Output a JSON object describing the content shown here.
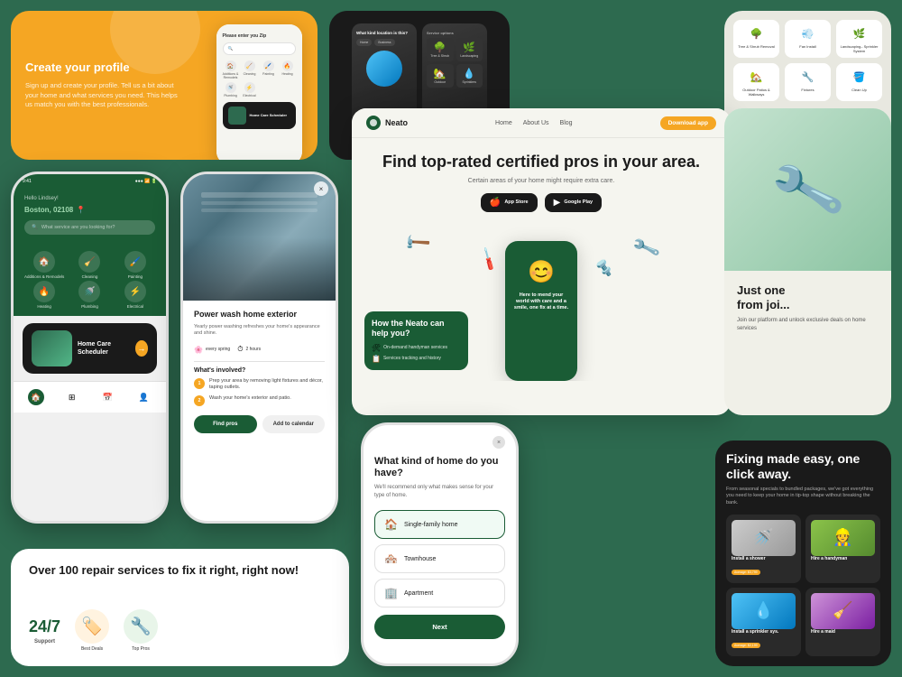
{
  "app": {
    "name": "Neato",
    "tagline": "Home Care Scheduler"
  },
  "colors": {
    "brand_green": "#1a5c35",
    "brand_orange": "#f5a623",
    "dark": "#1a1a1a",
    "light_bg": "#f5f5ef",
    "mid_green": "#2d6a4f"
  },
  "orange_card": {
    "title": "Create your profile",
    "description": "Sign up and create your profile. Tell us a bit about your home and what services you need. This helps us match you with the best professionals.",
    "phone_label": "Please enter you Zip",
    "phone_placeholder": "🔍",
    "badge_text": "Home Care\nScheduler"
  },
  "icon_grid": {
    "items": [
      {
        "label": "Additions\n& Remodels",
        "icon": "🏠"
      },
      {
        "label": "Cleaning",
        "icon": "🧹"
      },
      {
        "label": "Painting",
        "icon": "🖌️"
      },
      {
        "label": "Heating",
        "icon": "🔥"
      },
      {
        "label": "Plumbing",
        "icon": "🚿"
      },
      {
        "label": "Electrical",
        "icon": "⚡"
      }
    ]
  },
  "green_phone": {
    "status_time": "9:41",
    "greeting": "Hello Lindsey!",
    "city": "Boston, 02108",
    "search_placeholder": "What service are you looking for?",
    "nav_items": [
      "Home",
      "Services",
      "Calendar",
      "Profile"
    ]
  },
  "powerwash_card": {
    "title": "Power wash home exterior",
    "subtitle": "Yearly power washing refreshes your home's appearance and shine.",
    "frequency": "every spring",
    "duration": "2 hours",
    "involved_title": "What's involved?",
    "steps": [
      "Prep your area by removing light fixtures and decor, taping outlets.",
      "Wash your home's exterior and patio."
    ],
    "btn_find": "Find pros",
    "btn_calendar": "Add to calendar"
  },
  "desktop_website": {
    "logo": "Neato",
    "nav_links": [
      "Home",
      "About Us",
      "Blog"
    ],
    "cta_btn": "Download app",
    "hero_title": "Find top-rated certified\npros in your area.",
    "hero_subtitle": "Certain areas of your home might require extra care.",
    "store_btns": [
      "App Store",
      "Google Play"
    ],
    "how_title": "How the Neato\ncan help you?",
    "feature_1": "Here to mend your world with care and a smile, one fix at a time.",
    "feature_2": "On-demand handyman services",
    "feature_3": "Services tracking and history"
  },
  "home_type": {
    "title": "What kind of home do you have?",
    "subtitle": "We'll recommend only what makes sense for your type of home.",
    "options": [
      "Single-family home",
      "Townhouse",
      "Apartment"
    ],
    "btn_next": "Next",
    "close_icon": "×"
  },
  "bottom_banner": {
    "title": "Over 100 repair services to fix it right, right now!",
    "badge_247": "24/7",
    "badge_label": "Support"
  },
  "fixing_card": {
    "title": "Fixing made easy, one click away.",
    "subtitle": "From seasonal specials to bundled packages, we've got everything you need to keep your home in tip-top shape without breaking the bank.",
    "items": [
      {
        "title": "Install a shower",
        "badge": "Average: $3,799"
      },
      {
        "title": "Hire a handyman",
        "badge": ""
      },
      {
        "title": "Install a sprinkler sys.",
        "badge": "Average: $2,199"
      },
      {
        "title": "Hire a maid",
        "badge": ""
      }
    ]
  },
  "right_middle_card": {
    "title": "Just one\nfrom joi...",
    "subtitle": "Join our platform and unlock exclusive deals"
  },
  "dark_phones": {
    "question": "What kind\nlocation is\nthis?",
    "tabs": [
      "Home",
      "Business"
    ]
  }
}
